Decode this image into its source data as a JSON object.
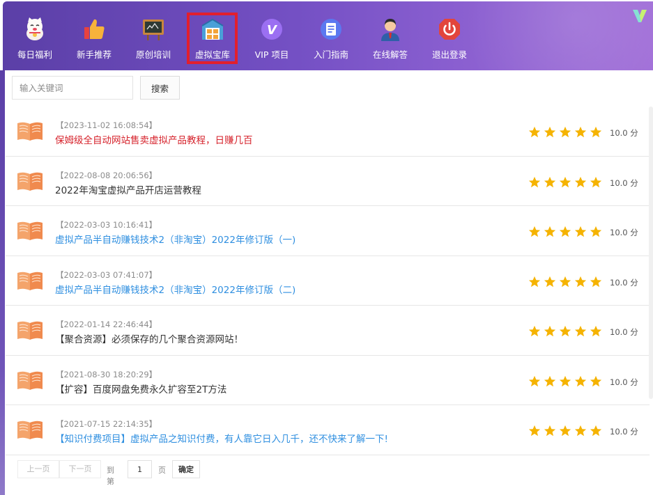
{
  "nav": {
    "items": [
      {
        "label": "每日福利",
        "icon": "lucky-cat-icon"
      },
      {
        "label": "新手推荐",
        "icon": "thumbs-up-icon"
      },
      {
        "label": "原创培训",
        "icon": "chalkboard-icon"
      },
      {
        "label": "虚拟宝库",
        "icon": "warehouse-icon",
        "active": true
      },
      {
        "label": "VIP 项目",
        "icon": "vip-icon"
      },
      {
        "label": "入门指南",
        "icon": "document-icon"
      },
      {
        "label": "在线解答",
        "icon": "support-agent-icon"
      },
      {
        "label": "退出登录",
        "icon": "power-icon"
      }
    ],
    "active_highlight_color": "#e21f2d"
  },
  "search": {
    "placeholder": "输入关键词",
    "button_label": "搜索"
  },
  "articles": [
    {
      "date": "【2023-11-02 16:08:54】",
      "title": "保姆级全自动网站售卖虚拟产品教程，日赚几百",
      "color": "red",
      "score": "10.0 分",
      "stars": 5
    },
    {
      "date": "【2022-08-08 20:06:56】",
      "title": "2022年淘宝虚拟产品开店运营教程",
      "color": "dark",
      "score": "10.0 分",
      "stars": 5
    },
    {
      "date": "【2022-03-03 10:16:41】",
      "title": "虚拟产品半自动赚钱技术2（非淘宝）2022年修订版（一)",
      "color": "blue",
      "score": "10.0 分",
      "stars": 5
    },
    {
      "date": "【2022-03-03 07:41:07】",
      "title": "虚拟产品半自动赚钱技术2（非淘宝）2022年修订版（二)",
      "color": "blue",
      "score": "10.0 分",
      "stars": 5
    },
    {
      "date": "【2022-01-14 22:46:44】",
      "title": "【聚合资源】必须保存的几个聚合资源网站！",
      "color": "dark",
      "score": "10.0 分",
      "stars": 5
    },
    {
      "date": "【2021-08-30 18:20:29】",
      "title": "【扩容】百度网盘免费永久扩容至2T方法",
      "color": "dark",
      "score": "10.0 分",
      "stars": 5
    },
    {
      "date": "【2021-07-15 22:14:35】",
      "title": "【知识付费项目】虚拟产品之知识付费，有人靠它日入几千，还不快来了解一下!",
      "color": "blue",
      "score": "10.0 分",
      "stars": 5
    }
  ],
  "pager": {
    "prev": "上一页",
    "next": "下一页",
    "goto_prefix": "到第",
    "page_value": "1",
    "goto_suffix": "页",
    "confirm": "确定"
  },
  "colors": {
    "star": "#f5b301",
    "title_red": "#d6232c",
    "title_blue": "#2f8fe0",
    "nav_gradient_start": "#5b3fa7",
    "nav_gradient_end": "#a16fd8"
  }
}
